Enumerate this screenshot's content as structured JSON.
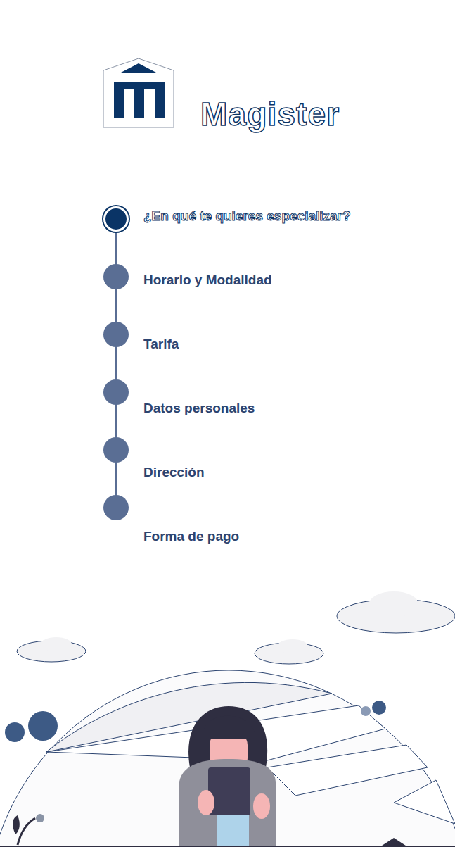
{
  "brand": {
    "name": "Magister"
  },
  "steps": [
    {
      "label": "¿En qué te quieres especializar?",
      "selected": true
    },
    {
      "label": "Horario y Modalidad",
      "selected": false
    },
    {
      "label": "Tarifa",
      "selected": false
    },
    {
      "label": "Datos personales",
      "selected": false
    },
    {
      "label": "Dirección",
      "selected": false
    },
    {
      "label": "Forma de pago",
      "selected": false
    }
  ]
}
